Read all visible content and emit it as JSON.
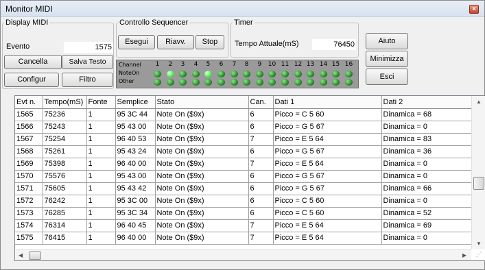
{
  "window": {
    "title": "Monitor MIDI",
    "close_glyph": "×"
  },
  "display_midi": {
    "legend": "Display MIDI",
    "event_label": "Evento",
    "event_value": "1575",
    "clear_button": "Cancella",
    "save_text_button": "Salva Testo",
    "config_button": "Configur",
    "filter_button": "Filtro"
  },
  "sequencer": {
    "legend": "Controllo Sequencer",
    "play_button": "Esegui",
    "reset_button": "Riavv.",
    "stop_button": "Stop"
  },
  "timer": {
    "legend": "Timer",
    "current_label": "Tempo Attuale(mS)",
    "current_value": "76450"
  },
  "side_buttons": {
    "help": "Aiuto",
    "minimize": "Minimizza",
    "exit": "Esci"
  },
  "leds": {
    "row_labels": [
      "Channel",
      "NoteOn",
      "Other"
    ],
    "channels": [
      "1",
      "2",
      "3",
      "4",
      "5",
      "6",
      "7",
      "8",
      "9",
      "10",
      "11",
      "12",
      "13",
      "14",
      "15",
      "16"
    ],
    "noteon_lit": [
      false,
      true,
      false,
      false,
      true,
      false,
      false,
      false,
      false,
      false,
      false,
      false,
      false,
      false,
      false,
      false
    ],
    "other_lit": [
      false,
      false,
      false,
      false,
      false,
      false,
      false,
      false,
      false,
      false,
      false,
      false,
      false,
      false,
      false,
      false
    ],
    "colors": {
      "panel": "#9a9a9a",
      "led_off": "#1b7d1b",
      "led_on": "#5df05d"
    }
  },
  "table": {
    "columns": [
      "Evt n.",
      "Tempo(mS)",
      "Fonte",
      "Semplice",
      "Stato",
      "Can.",
      "Dati 1",
      "Dati 2"
    ],
    "rows": [
      [
        "1565",
        "75236",
        "1",
        "95 3C 44",
        "Note On ($9x)",
        "6",
        "Picco = C 5 60",
        "Dinamica = 68"
      ],
      [
        "1566",
        "75243",
        "1",
        "95 43 00",
        "Note On ($9x)",
        "6",
        "Picco = G 5 67",
        "Dinamica = 0"
      ],
      [
        "1567",
        "75254",
        "1",
        "96 40 53",
        "Note On ($9x)",
        "7",
        "Picco = E 5 64",
        "Dinamica = 83"
      ],
      [
        "1568",
        "75261",
        "1",
        "95 43 24",
        "Note On ($9x)",
        "6",
        "Picco = G 5 67",
        "Dinamica = 36"
      ],
      [
        "1569",
        "75398",
        "1",
        "96 40 00",
        "Note On ($9x)",
        "7",
        "Picco = E 5 64",
        "Dinamica = 0"
      ],
      [
        "1570",
        "75576",
        "1",
        "95 43 00",
        "Note On ($9x)",
        "6",
        "Picco = G 5 67",
        "Dinamica = 0"
      ],
      [
        "1571",
        "75605",
        "1",
        "95 43 42",
        "Note On ($9x)",
        "6",
        "Picco = G 5 67",
        "Dinamica = 66"
      ],
      [
        "1572",
        "76242",
        "1",
        "95 3C 00",
        "Note On ($9x)",
        "6",
        "Picco = C 5 60",
        "Dinamica = 0"
      ],
      [
        "1573",
        "76285",
        "1",
        "95 3C 34",
        "Note On ($9x)",
        "6",
        "Picco = C 5 60",
        "Dinamica = 52"
      ],
      [
        "1574",
        "76314",
        "1",
        "96 40 45",
        "Note On ($9x)",
        "7",
        "Picco = E 5 64",
        "Dinamica = 69"
      ],
      [
        "1575",
        "76415",
        "1",
        "96 40 00",
        "Note On ($9x)",
        "7",
        "Picco = E 5 64",
        "Dinamica = 0"
      ]
    ]
  },
  "scroll": {
    "up": "▲",
    "down": "▼",
    "left": "◀",
    "right": "▶",
    "grip": "⋰"
  }
}
